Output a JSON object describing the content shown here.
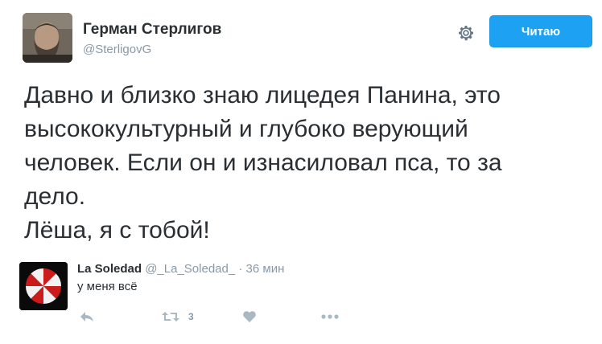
{
  "author": {
    "name": "Герман Стерлигов",
    "handle": "@SterligovG",
    "avatar_icon": "user-photo"
  },
  "actions": {
    "follow_label": "Читаю",
    "settings_icon": "gear-icon"
  },
  "tweet": {
    "lines": [
      "Давно и близко знаю лицедея Панина, это",
      "высококультурный и глубоко верующий",
      "человек. Если он и изнасиловал пса, то за",
      "дело.",
      "Лёша, я с тобой!"
    ]
  },
  "reply": {
    "name": "La Soledad",
    "handle": "@_La_Soledad_",
    "separator": "·",
    "time": "36 мин",
    "text": "у меня всё",
    "avatar_icon": "umbrella-logo",
    "retweet_count": "3"
  },
  "colors": {
    "accent": "#1da1f2",
    "muted": "#8899a6",
    "icon": "#aab8c2",
    "text": "#292f33"
  }
}
